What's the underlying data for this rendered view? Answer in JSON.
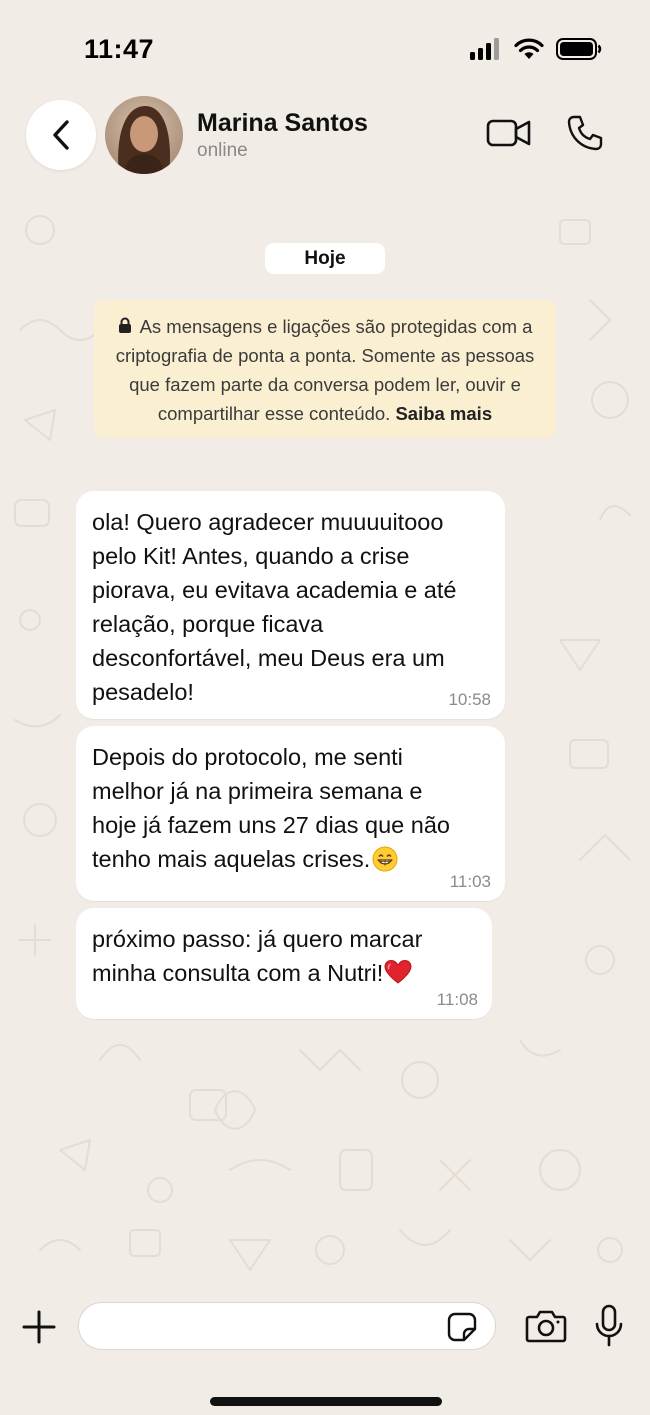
{
  "status_bar": {
    "time": "11:47",
    "icons": [
      "cellular-signal-icon",
      "wifi-icon",
      "battery-icon"
    ]
  },
  "header": {
    "back_icon": "chevron-left-icon",
    "contact_name": "Marina Santos",
    "contact_status": "online",
    "video_icon": "video-camera-icon",
    "call_icon": "phone-icon"
  },
  "chat": {
    "date_label": "Hoje",
    "encryption_notice": {
      "text": "As mensagens e ligações são protegidas com a criptografia de ponta a ponta. Somente as pessoas que fazem parte da conversa podem ler, ouvir e compartilhar esse conteúdo.",
      "link": "Saiba mais"
    },
    "messages": [
      {
        "text": "ola! Quero agradecer muuuuitooo\npelo Kit! Antes, quando a crise\npiorava, eu evitava academia e até\nrelação, porque ficava\ndesconfortável, meu Deus era um\npesadelo!",
        "time": "10:58"
      },
      {
        "text": "Depois do protocolo, me senti\nmelhor já na primeira semana e\nhoje já fazem uns 27 dias que não\ntenho mais aquelas crises.",
        "emoji": "grinning-face-emoji",
        "time": "11:03"
      },
      {
        "text": "próximo passo: já quero marcar\nminha consulta com a Nutri!",
        "emoji": "red-heart-emoji",
        "time": "11:08"
      }
    ]
  },
  "input_bar": {
    "placeholder": "",
    "icons": [
      "plus-icon",
      "sticker-icon",
      "camera-icon",
      "microphone-icon"
    ]
  },
  "colors": {
    "background": "#F1ECE5",
    "bubble": "#FFFFFF",
    "encryption_bg": "#FBEFD2",
    "timestamp": "#8B8B8B",
    "secondary_text": "#8A8A8A"
  }
}
